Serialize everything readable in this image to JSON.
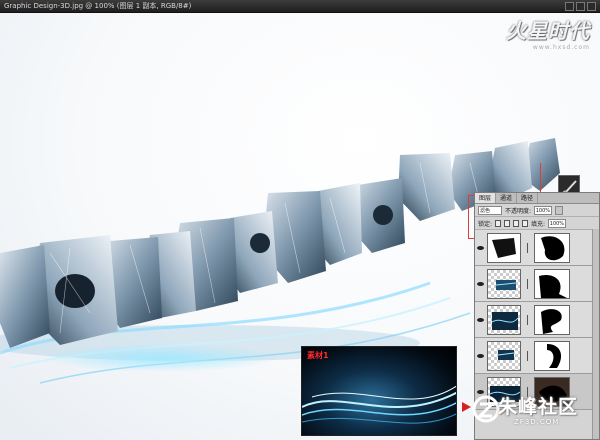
{
  "window": {
    "title": "Graphic Design-3D.jpg @ 100% (图层 1 副本, RGB/8#)"
  },
  "logo": {
    "main": "火星时代",
    "sub": "www.hxsd.com"
  },
  "layers_panel": {
    "tabs": [
      "图层",
      "通道",
      "路径"
    ],
    "blend_mode": "滤色",
    "opacity_label": "不透明度:",
    "opacity_value": "100%",
    "lock_label": "锁定:",
    "fill_label": "填充:",
    "fill_value": "100%",
    "layers": [
      {
        "id": "layer-1",
        "selected": false
      },
      {
        "id": "layer-2",
        "selected": false
      },
      {
        "id": "layer-3",
        "selected": false
      },
      {
        "id": "layer-4",
        "selected": false
      },
      {
        "id": "layer-5",
        "selected": true
      }
    ]
  },
  "inset": {
    "label": "素材1"
  },
  "watermark": {
    "text": "朱峰社区",
    "sub": "ZF3D.COM"
  },
  "colors": {
    "accent_red": "#e23b3b",
    "titlebar": "#2a2a2a",
    "panel_bg": "#d4d4d4"
  },
  "icons": [
    "brush-icon",
    "eye-icon",
    "lock-icon",
    "chain-icon",
    "arrow-icon"
  ]
}
